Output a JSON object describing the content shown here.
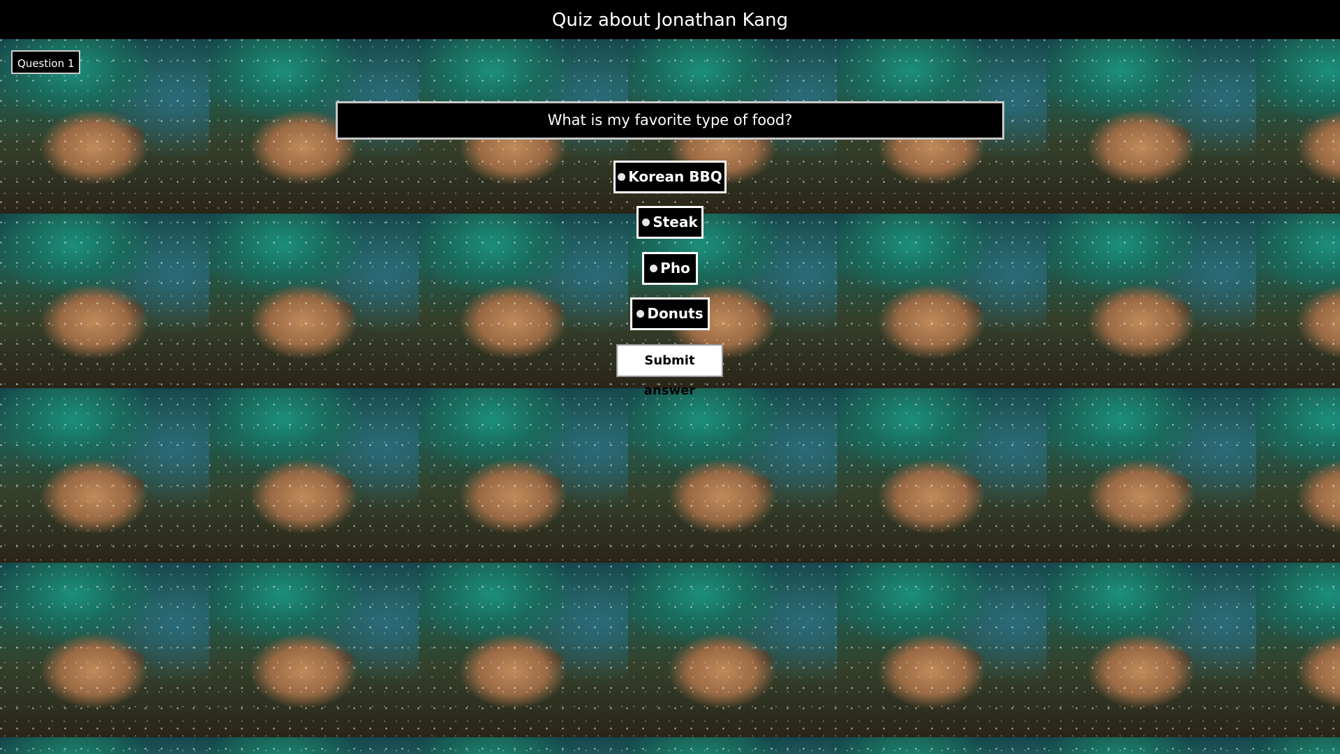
{
  "app": {
    "title": "Quiz about Jonathan Kang"
  },
  "quiz": {
    "question_badge": "Question 1",
    "question_text": "What is my favorite type of food?",
    "options": [
      {
        "label": "Korean BBQ",
        "selected": false
      },
      {
        "label": "Steak",
        "selected": false
      },
      {
        "label": "Pho",
        "selected": false
      },
      {
        "label": "Donuts",
        "selected": false
      }
    ],
    "submit_label": "Submit answer"
  },
  "theme": {
    "bar_color": "#000000",
    "text_color": "#ffffff",
    "background_motif": "space-cat-tiled-image"
  }
}
